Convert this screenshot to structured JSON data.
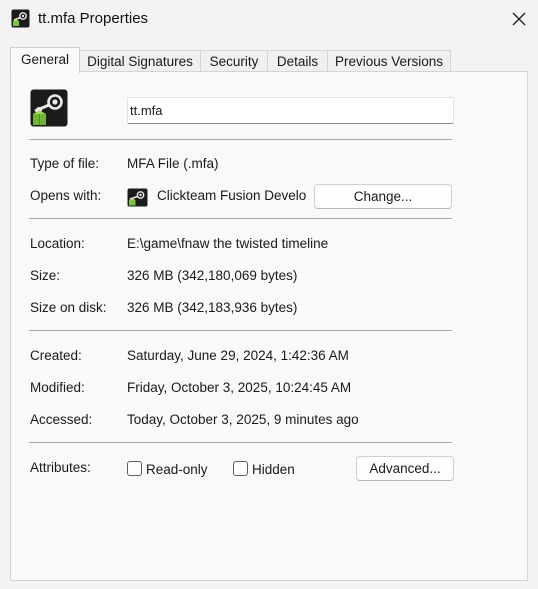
{
  "window": {
    "title": "tt.mfa Properties",
    "icon": "steam-file-icon",
    "close_icon": "close-icon"
  },
  "tabs": [
    {
      "label": "General",
      "active": true
    },
    {
      "label": "Digital Signatures",
      "active": false
    },
    {
      "label": "Security",
      "active": false
    },
    {
      "label": "Details",
      "active": false
    },
    {
      "label": "Previous Versions",
      "active": false
    }
  ],
  "general": {
    "file_name": "tt.mfa",
    "type_label": "Type of file:",
    "type_value": "MFA File (.mfa)",
    "opens_label": "Opens with:",
    "opens_value": "Clickteam Fusion Develo",
    "change_button": "Change...",
    "location_label": "Location:",
    "location_value": "E:\\game\\fnaw the twisted timeline",
    "size_label": "Size:",
    "size_value": "326 MB (342,180,069 bytes)",
    "size_on_disk_label": "Size on disk:",
    "size_on_disk_value": "326 MB (342,183,936 bytes)",
    "created_label": "Created:",
    "created_value": "Saturday, June 29, 2024, 1:42:36 AM",
    "modified_label": "Modified:",
    "modified_value": "Friday, October 3, 2025, 10:24:45 AM",
    "accessed_label": "Accessed:",
    "accessed_value": "Today, October 3, 2025, 9 minutes ago",
    "attributes_label": "Attributes:",
    "readonly_label": "Read-only",
    "readonly_checked": false,
    "hidden_label": "Hidden",
    "hidden_checked": false,
    "advanced_button": "Advanced..."
  },
  "colors": {
    "window_bg": "#f3f3f3",
    "panel_bg": "#f9f9f9",
    "icon_dark": "#1b1b1b",
    "icon_green": "#7cc33a"
  }
}
